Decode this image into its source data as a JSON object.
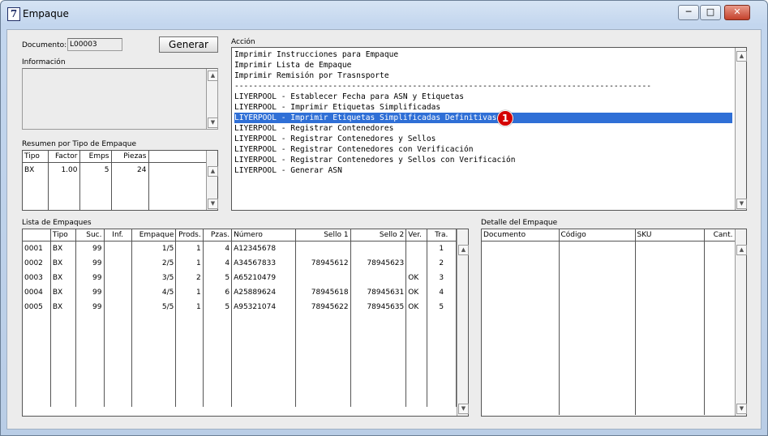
{
  "window": {
    "title": "Empaque",
    "icon": "7"
  },
  "documento": {
    "label": "Documento:",
    "value": "L00003"
  },
  "generar_label": "Generar",
  "informacion_label": "Información",
  "accion": {
    "label": "Acción",
    "items": [
      "Imprimir Instrucciones para Empaque",
      "Imprimir Lista de Empaque",
      "Imprimir Remisión por Trasnsporte",
      "-----------------------------------------------------------------------------------------",
      "LIYERPOOL - Establecer Fecha para ASN y Etiquetas",
      "LIYERPOOL - Imprimir Etiquetas Simplificadas",
      "LIYERPOOL - Imprimir Etiquetas Simplificadas Definitivas",
      "LIYERPOOL - Registrar Contenedores",
      "LIYERPOOL - Registrar Contenedores y Sellos",
      "LIYERPOOL - Registrar Contenedores con Verificación",
      "LIYERPOOL - Registrar Contenedores y Sellos con Verificación",
      "LIYERPOOL - Generar ASN"
    ],
    "selected_index": 6,
    "badge": "1"
  },
  "resumen": {
    "label": "Resumen por Tipo de Empaque",
    "headers": [
      "Tipo",
      "Factor",
      "Emps",
      "Piezas"
    ],
    "rows": [
      [
        "BX",
        "1.00",
        "5",
        "24"
      ]
    ]
  },
  "lista": {
    "label": "Lista de Empaques",
    "headers": [
      "",
      "Tipo",
      "Suc.",
      "Inf.",
      "Empaque",
      "Prods.",
      "Pzas.",
      "Número",
      "Sello 1",
      "Sello 2",
      "Ver.",
      "Tra."
    ],
    "rows": [
      [
        "0001",
        "BX",
        "99",
        "",
        "1/5",
        "1",
        "4",
        "A12345678",
        "",
        "",
        "",
        "1"
      ],
      [
        "0002",
        "BX",
        "99",
        "",
        "2/5",
        "1",
        "4",
        "A34567833",
        "78945612",
        "78945623",
        "",
        "2"
      ],
      [
        "0003",
        "BX",
        "99",
        "",
        "3/5",
        "2",
        "5",
        "A65210479",
        "",
        "",
        "OK",
        "3"
      ],
      [
        "0004",
        "BX",
        "99",
        "",
        "4/5",
        "1",
        "6",
        "A25889624",
        "78945618",
        "78945631",
        "OK",
        "4"
      ],
      [
        "0005",
        "BX",
        "99",
        "",
        "5/5",
        "1",
        "5",
        "A95321074",
        "78945622",
        "78945635",
        "OK",
        "5"
      ]
    ]
  },
  "detalle": {
    "label": "Detalle del Empaque",
    "headers": [
      "Documento",
      "Código",
      "SKU",
      "Cant."
    ]
  }
}
